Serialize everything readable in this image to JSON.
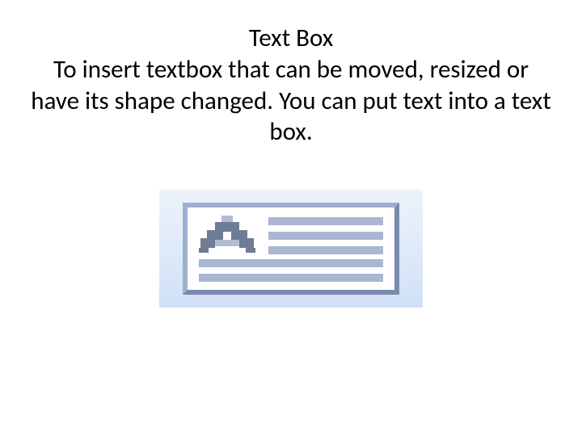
{
  "title": "Text Box",
  "description": "To insert textbox that can be moved, resized or have its shape changed. You can put text into a text box."
}
